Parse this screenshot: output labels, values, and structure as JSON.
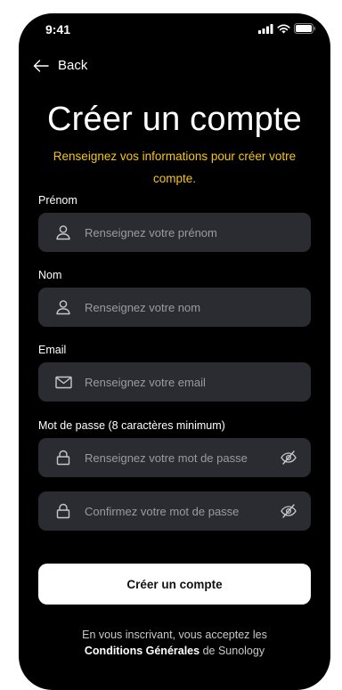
{
  "status_bar": {
    "time": "9:41"
  },
  "nav": {
    "back_label": "Back"
  },
  "header": {
    "title": "Créer un compte",
    "subtitle": "Renseignez vos informations pour créer votre compte."
  },
  "form": {
    "firstname": {
      "label": "Prénom",
      "placeholder": "Renseignez votre prénom",
      "icon": "user-icon"
    },
    "lastname": {
      "label": "Nom",
      "placeholder": "Renseignez votre nom",
      "icon": "user-icon"
    },
    "email": {
      "label": "Email",
      "placeholder": "Renseignez votre email",
      "icon": "mail-icon"
    },
    "password": {
      "label": "Mot de passe (8 caractères minimum)",
      "placeholder": "Renseignez votre mot de passe",
      "icon": "lock-icon",
      "toggle_icon": "eye-off-icon"
    },
    "password_confirm": {
      "placeholder": "Confirmez votre mot de passe",
      "icon": "lock-icon",
      "toggle_icon": "eye-off-icon"
    }
  },
  "actions": {
    "submit_label": "Créer un compte"
  },
  "terms": {
    "prefix": "En vous inscrivant, vous acceptez les",
    "link": "Conditions Générales",
    "suffix": "de Sunology"
  },
  "colors": {
    "background": "#000000",
    "field_bg": "#2b2c31",
    "accent": "#f5c518",
    "button_bg": "#ffffff"
  }
}
